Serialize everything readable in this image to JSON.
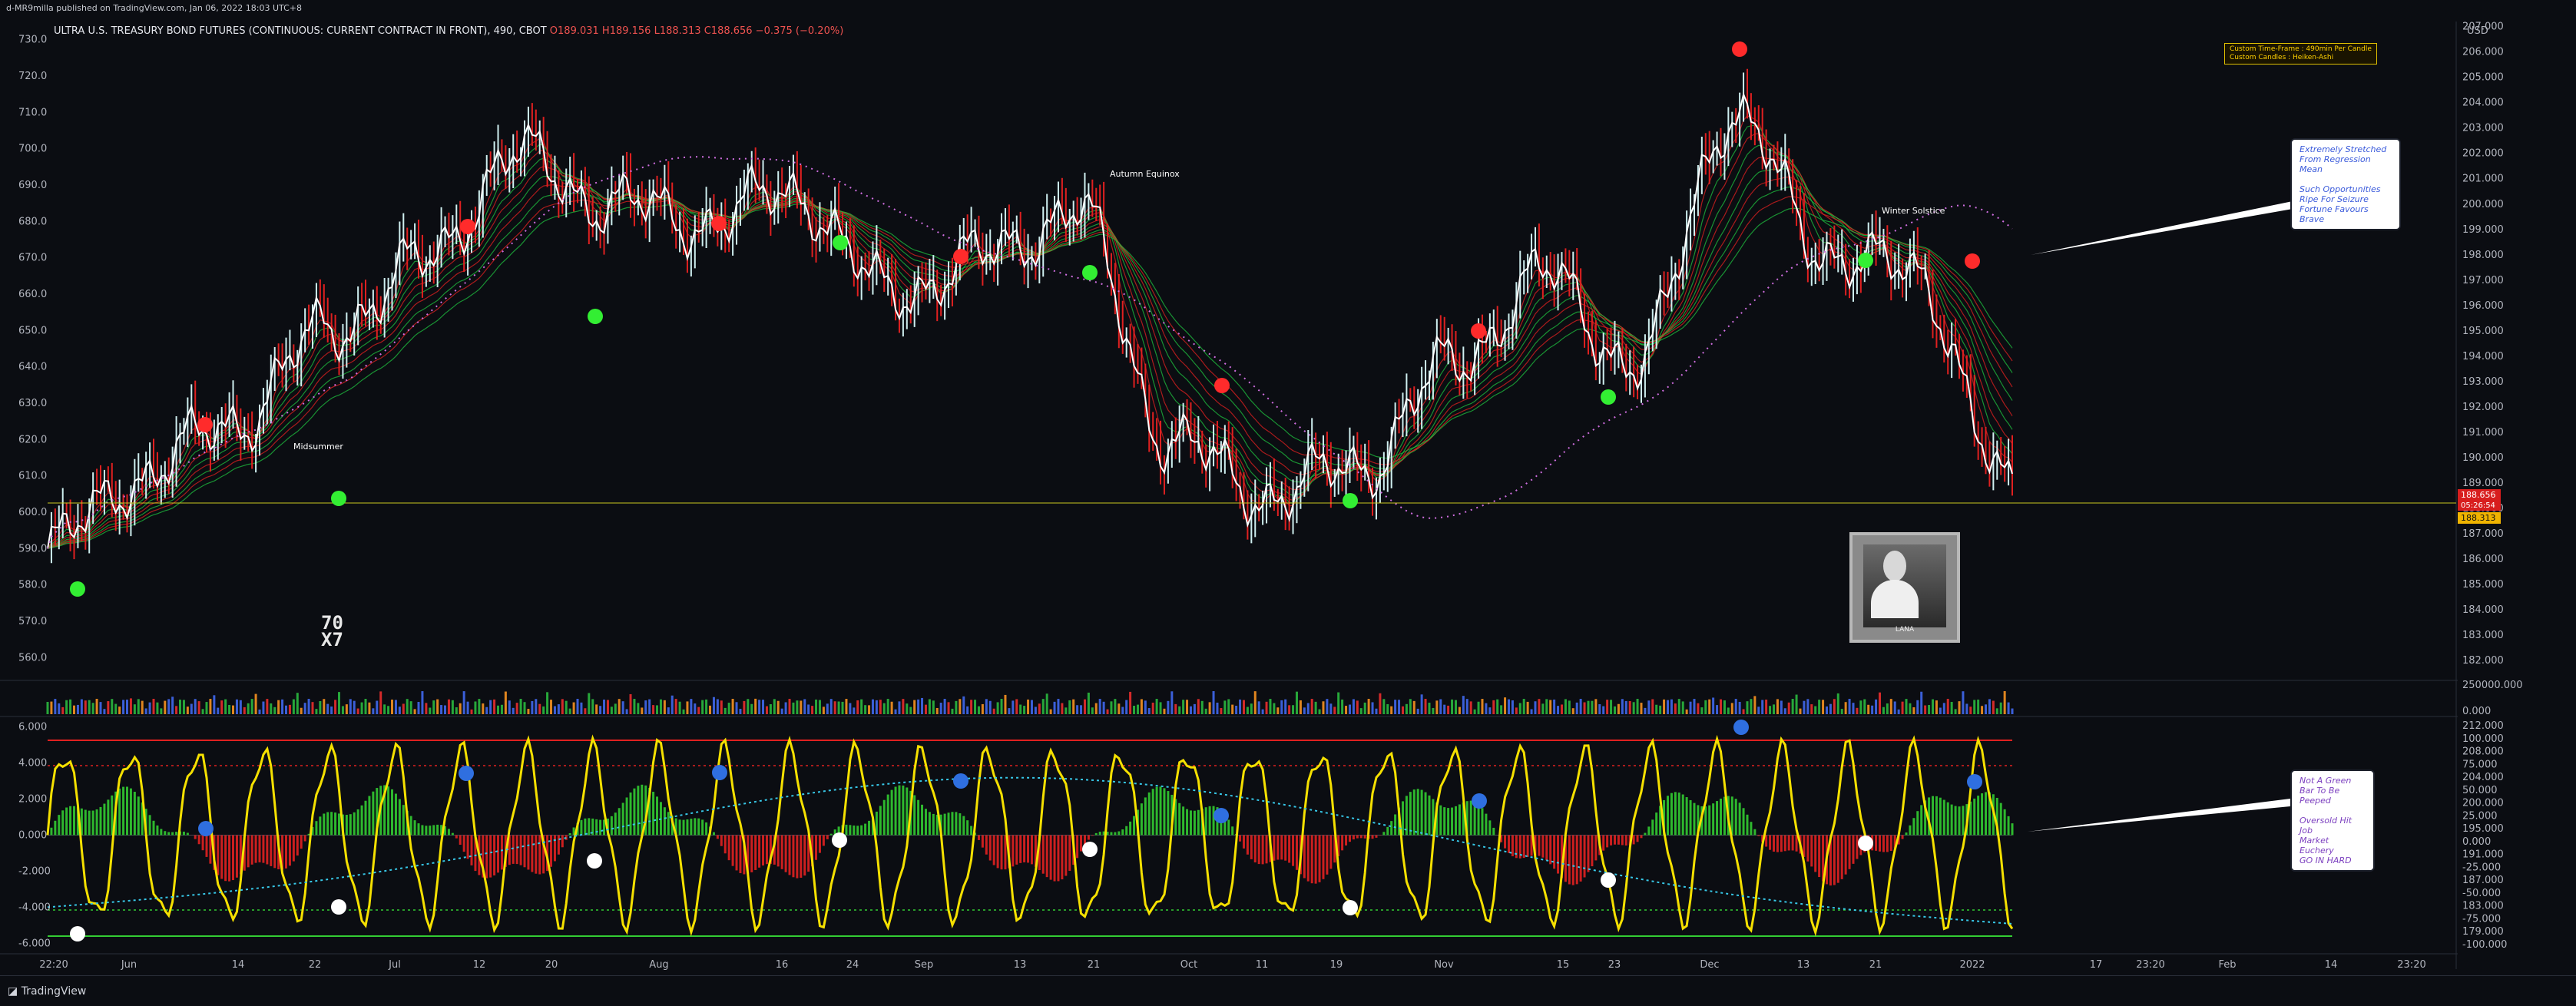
{
  "publisher_line": "d-MR9milla published on TradingView.com, Jan 06, 2022 18:03 UTC+8",
  "title": {
    "symbol": "ULTRA U.S. TREASURY BOND FUTURES (CONTINUOUS: CURRENT CONTRACT IN FRONT), 490, CBOT",
    "ohlc": "O189.031  H189.156  L188.313  C188.656  −0.375 (−0.20%)"
  },
  "brand": "TradingView",
  "currency": "USD",
  "custom_box": [
    "Custom Time-Frame : 490min Per Candle",
    "Custom Candles : Heiken-Ashi"
  ],
  "note_top": [
    "Extremely Stretched",
    "From Regression Mean",
    "",
    "Such Opportunities",
    "Ripe For Seizure",
    "Fortune Favours",
    "Brave"
  ],
  "note_bottom": [
    "Not A Green",
    "Bar To Be",
    "Peeped",
    "",
    "Oversold Hit Job",
    "Market Euchery",
    "GO IN HARD"
  ],
  "watermark": [
    "70",
    "X7"
  ],
  "photo_caption": "LANA",
  "annotations": [
    "Midsummer",
    "Autumn Equinox",
    "Winter Solstice"
  ],
  "price_tags": {
    "last": "188.656",
    "countdown": "05:26:54",
    "low": "188.313"
  },
  "colors": {
    "bull": "#1fbf3f",
    "bear": "#e02020",
    "price": "#ffffff",
    "osc": "#f5e000",
    "signal": "#37c8e8",
    "dot_red": "#ff2b2b",
    "dot_green": "#33ee33",
    "dot_blue": "#2f6fe0",
    "dot_white": "#ffffff",
    "vol_green": "#27a83a",
    "vol_red": "#d42a2a",
    "vol_blue": "#3b5fd8",
    "vol_orange": "#e0851f"
  },
  "chart_data": [
    {
      "type": "line",
      "name": "price-panel",
      "x": [
        "Jun",
        "14",
        "22",
        "Jul",
        "12",
        "20",
        "Aug",
        "16",
        "24",
        "Sep",
        "13",
        "21",
        "Oct",
        "11",
        "19",
        "Nov",
        "15",
        "23",
        "Dec",
        "13",
        "21",
        "2022"
      ],
      "values": [
        590,
        610,
        625,
        650,
        668,
        698,
        685,
        680,
        688,
        660,
        670,
        683,
        620,
        605,
        612,
        640,
        665,
        640,
        710,
        672,
        665,
        604
      ],
      "left_axis": {
        "ticks": [
          "730.0",
          "720.0",
          "710.0",
          "700.0",
          "690.0",
          "680.0",
          "670.0",
          "660.0",
          "650.0",
          "640.0",
          "630.0",
          "620.0",
          "610.0",
          "600.0",
          "590.0",
          "580.0",
          "570.0",
          "560.0"
        ],
        "range": [
          555,
          735
        ]
      },
      "right_axis": {
        "ticks": [
          "207.000",
          "206.000",
          "205.000",
          "204.000",
          "203.000",
          "202.000",
          "201.000",
          "200.000",
          "199.000",
          "198.000",
          "197.000",
          "196.000",
          "195.000",
          "194.000",
          "193.000",
          "192.000",
          "191.000",
          "190.000",
          "189.000",
          "188.000",
          "187.000",
          "186.000",
          "185.000",
          "184.000",
          "183.000",
          "182.000"
        ],
        "range": [
          181.4,
          207.2
        ]
      }
    },
    {
      "type": "bar",
      "name": "volume",
      "right_axis": {
        "ticks": [
          "250000.000",
          "0.000"
        ]
      }
    },
    {
      "type": "line",
      "name": "oscillator",
      "left_axis": {
        "ticks": [
          "6.000",
          "4.000",
          "2.000",
          "0.000",
          "-2.000",
          "-4.000",
          "-6.000"
        ],
        "range": [
          -6.5,
          6.5
        ]
      },
      "right_axis": {
        "ticks": [
          "212.000",
          "100.000",
          "208.000",
          "75.000",
          "204.000",
          "50.000",
          "200.000",
          "25.000",
          "195.000",
          "0.000",
          "191.000",
          "-25.000",
          "187.000",
          "-50.000",
          "183.000",
          "-75.000",
          "179.000",
          "-100.000"
        ]
      }
    }
  ],
  "time_axis": [
    "22:20",
    "Jun",
    "14",
    "22",
    "Jul",
    "12",
    "20",
    "Aug",
    "16",
    "24",
    "Sep",
    "13",
    "21",
    "Oct",
    "11",
    "19",
    "Nov",
    "15",
    "23",
    "Dec",
    "13",
    "21",
    "2022",
    "17",
    "23:20",
    "Feb",
    "14",
    "23:20"
  ]
}
